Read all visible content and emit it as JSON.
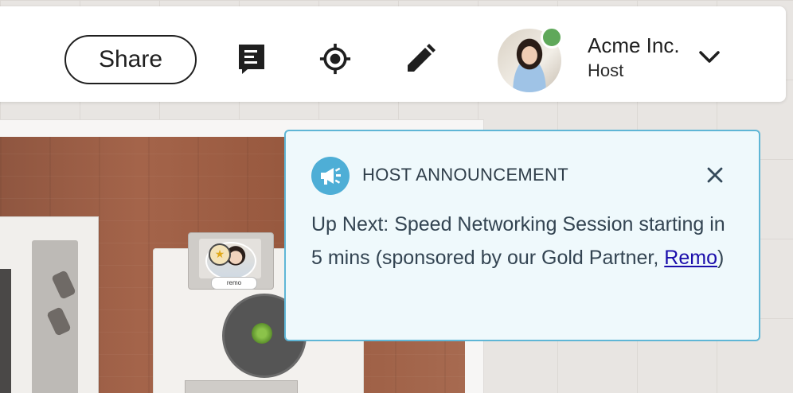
{
  "topbar": {
    "share_label": "Share",
    "icons": [
      "notes-icon",
      "locate-icon",
      "edit-icon"
    ],
    "user": {
      "name": "Acme Inc.",
      "role": "Host",
      "status": "online",
      "status_color": "#5fa85a"
    }
  },
  "announcement": {
    "title": "HOST ANNOUNCEMENT",
    "body_prefix": "Up Next: Speed Networking Session starting in 5 mins (sponsored by our Gold Partner, ",
    "link_text": "Remo",
    "body_suffix": ")",
    "accent_color": "#4eaed6",
    "background_color": "#eff9fc"
  },
  "floorplan": {
    "table_tag": "remo"
  }
}
